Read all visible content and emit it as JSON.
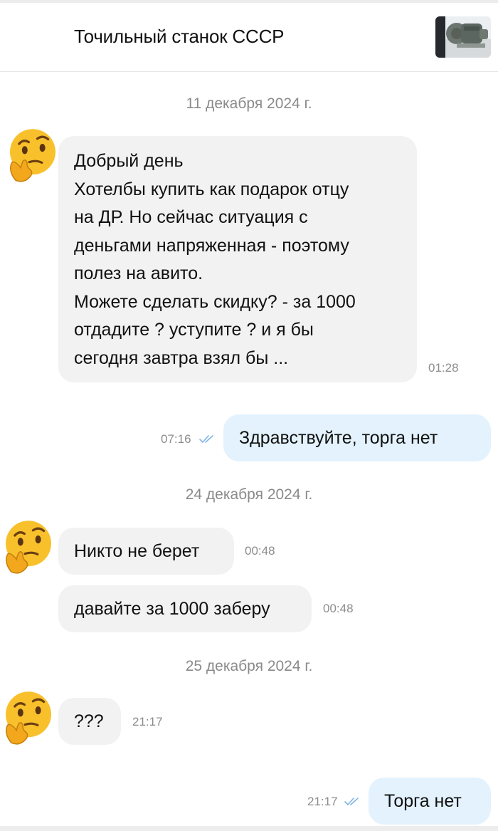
{
  "header": {
    "title": "Точильный станок СССР"
  },
  "dates": [
    "11 декабря 2024 г.",
    "24 декабря 2024 г.",
    "25 декабря 2024 г."
  ],
  "messages": [
    {
      "direction": "incoming",
      "lines": [
        "Добрый день",
        "Хотелбы купить как подарок отцу",
        "на ДР. Но сейчас ситуация с",
        "деньгами напряженная - поэтому",
        "полез на авито.",
        "Можете сделать скидку? - за 1000",
        "отдадите ? уступите ? и я бы",
        "сегодня завтра взял бы ..."
      ],
      "time": "01:28"
    },
    {
      "direction": "outgoing",
      "text": "Здравствуйте,  торга нет",
      "time": "07:16",
      "status": "read"
    },
    {
      "direction": "incoming",
      "text": "Никто не берет",
      "time": "00:48"
    },
    {
      "direction": "incoming",
      "text": "давайте за 1000 заберу",
      "time": "00:48"
    },
    {
      "direction": "incoming",
      "text": "???",
      "time": "21:17"
    },
    {
      "direction": "outgoing",
      "text": "Торга нет",
      "time": "21:17",
      "status": "read"
    }
  ],
  "icons": {
    "avatar": "thinking-face-emoji",
    "read_status": "double-check-icon"
  },
  "colors": {
    "incoming_bubble": "#f2f2f2",
    "outgoing_bubble": "#e3f2fd",
    "check": "#7fb6e6",
    "muted_text": "#8c8c8c"
  }
}
